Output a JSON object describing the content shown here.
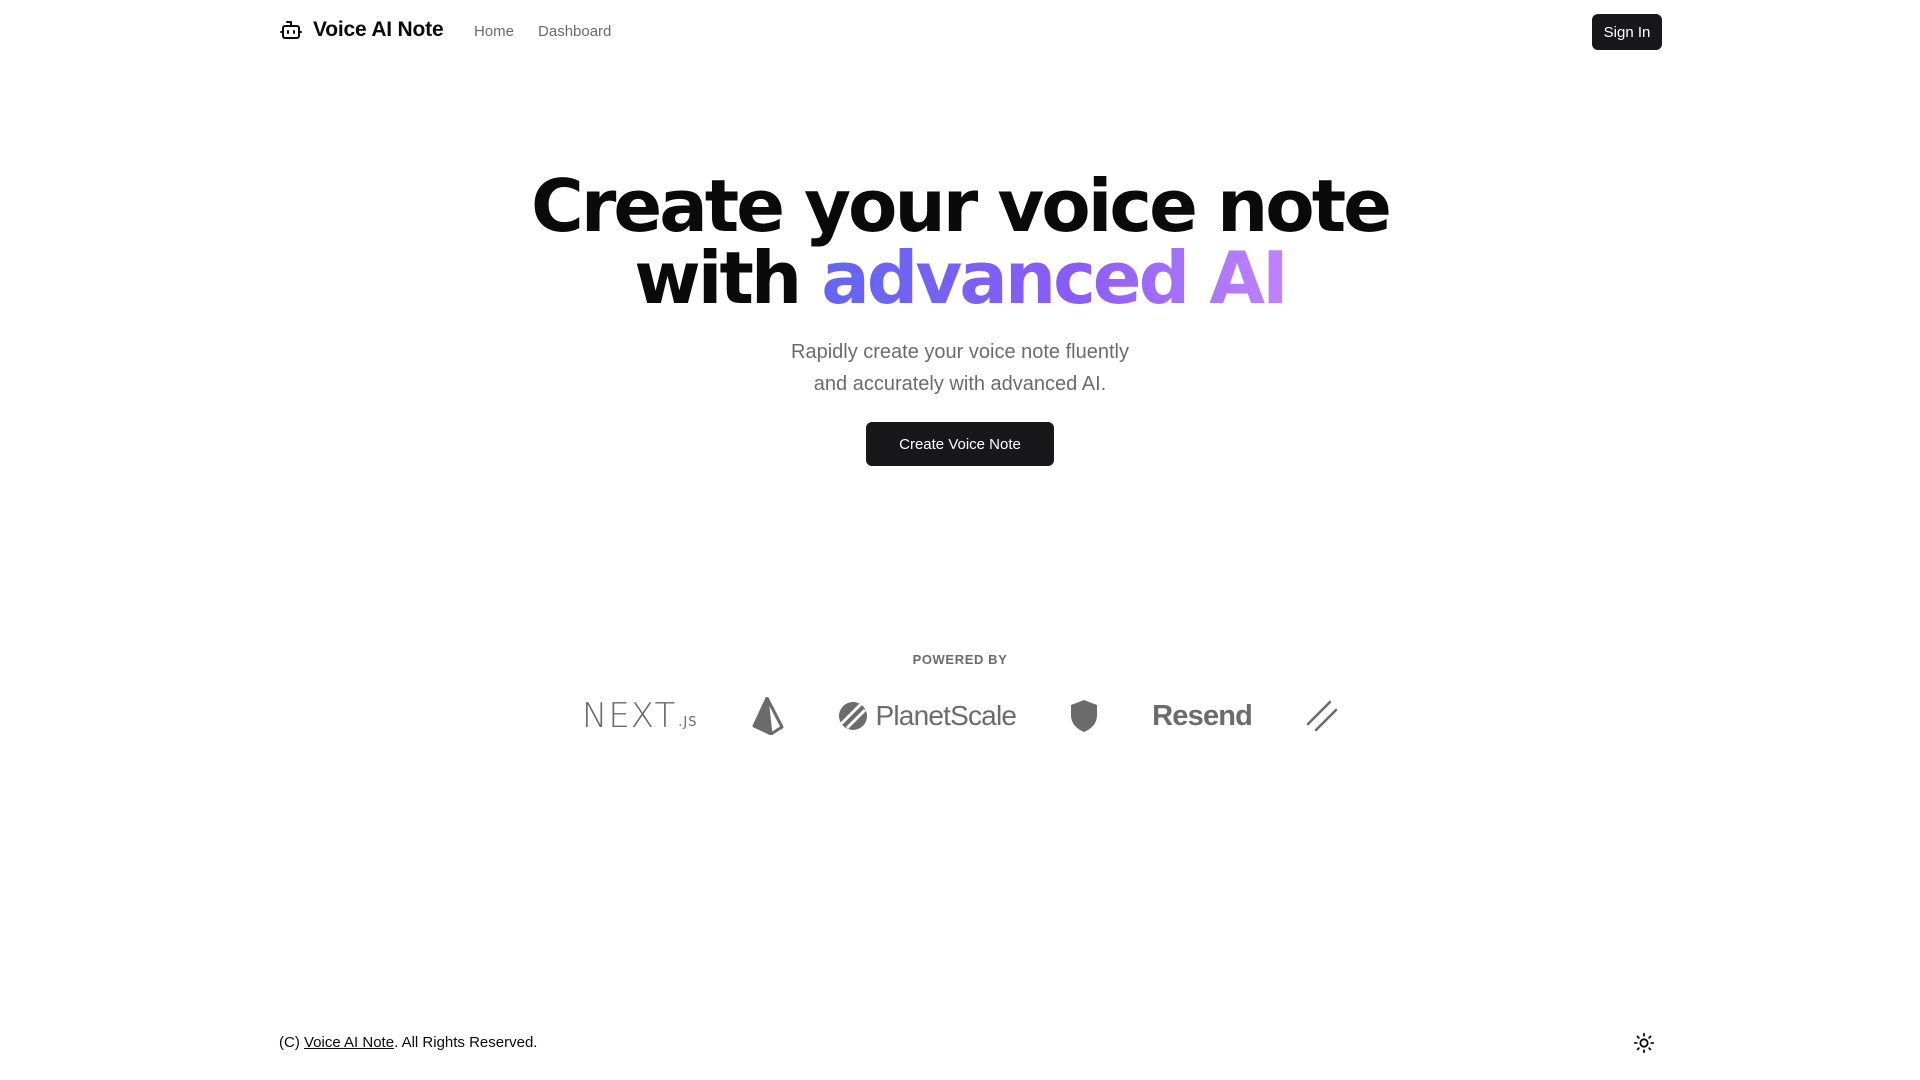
{
  "header": {
    "brand": "Voice AI Note",
    "nav": [
      {
        "label": "Home"
      },
      {
        "label": "Dashboard"
      }
    ],
    "signin_label": "Sign In"
  },
  "hero": {
    "title_line1": "Create your voice note",
    "title_with": "with ",
    "title_highlight": "advanced AI",
    "subtitle_line1": "Rapidly create your voice note fluently",
    "subtitle_line2": "and accurately with advanced AI.",
    "cta_label": "Create Voice Note",
    "gradient_colors": [
      "#6366f1",
      "#8b5cf6",
      "#c084fc"
    ]
  },
  "powered": {
    "label": "POWERED BY",
    "logos": [
      {
        "icon": "nextjs-logo",
        "text": "NEXT",
        "suffix": ".JS"
      },
      {
        "icon": "prisma-logo"
      },
      {
        "icon": "planetscale-logo",
        "text": "PlanetScale"
      },
      {
        "icon": "shield-logo"
      },
      {
        "icon": "resend-logo",
        "text": "Resend"
      },
      {
        "icon": "slash-logo"
      }
    ]
  },
  "footer": {
    "prefix": "(C) ",
    "link": "Voice AI Note",
    "suffix": ". All Rights Reserved."
  },
  "theme_toggle": {
    "icon": "sun-icon"
  },
  "colors": {
    "primary": "#18181b",
    "muted": "#6b6b6b",
    "background": "#ffffff"
  }
}
